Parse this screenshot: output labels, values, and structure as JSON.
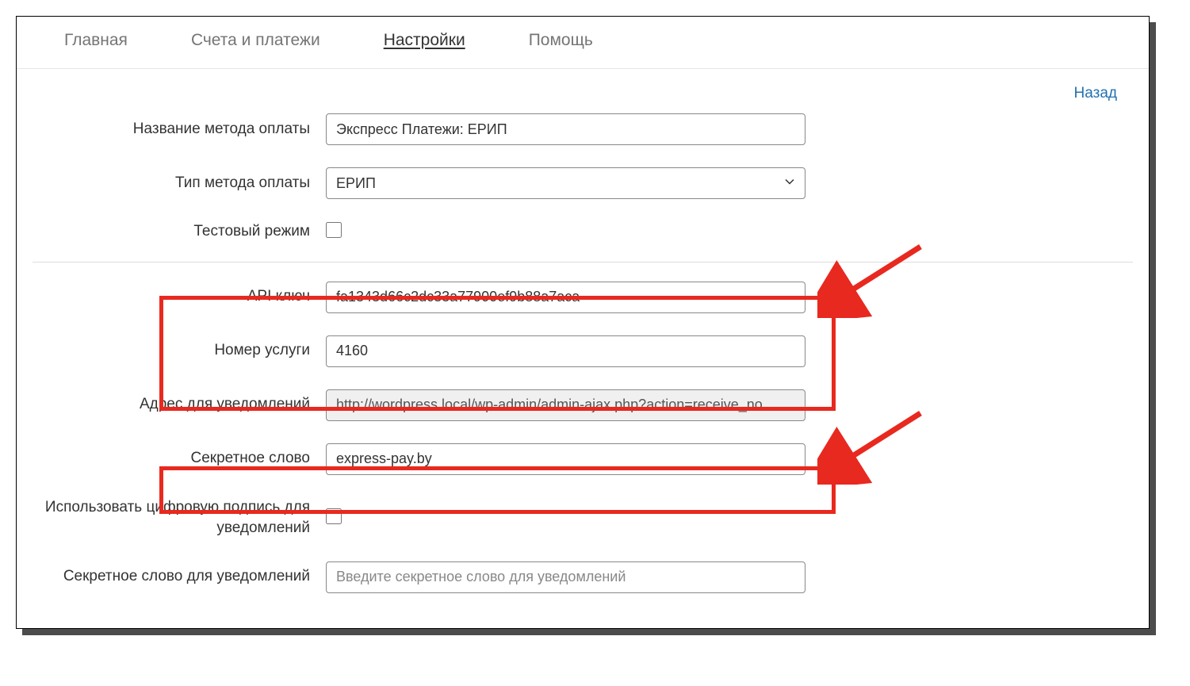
{
  "tabs": {
    "main": "Главная",
    "invoices": "Счета и платежи",
    "settings": "Настройки",
    "help": "Помощь"
  },
  "back_link": "Назад",
  "fields": {
    "payment_method_name": {
      "label": "Название метода оплаты",
      "value": "Экспресс Платежи: ЕРИП"
    },
    "payment_method_type": {
      "label": "Тип метода оплаты",
      "value": "ЕРИП"
    },
    "test_mode": {
      "label": "Тестовый режим"
    },
    "api_key": {
      "label": "API ключ",
      "value": "fa1343d66c2dc33a77900ef9b88a7aca"
    },
    "service_number": {
      "label": "Номер услуги",
      "value": "4160"
    },
    "notification_url": {
      "label": "Адрес для уведомлений",
      "value": "http://wordpress.local/wp-admin/admin-ajax.php?action=receive_no"
    },
    "secret_word": {
      "label": "Секретное слово",
      "value": "express-pay.by"
    },
    "use_digital_signature": {
      "label": "Использовать цифровую подпись для уведомлений"
    },
    "secret_word_notifications": {
      "label": "Секретное слово для уведомлений",
      "placeholder": "Введите секретное слово для уведомлений"
    }
  },
  "annotation": {
    "highlight_color": "#e8291f"
  }
}
